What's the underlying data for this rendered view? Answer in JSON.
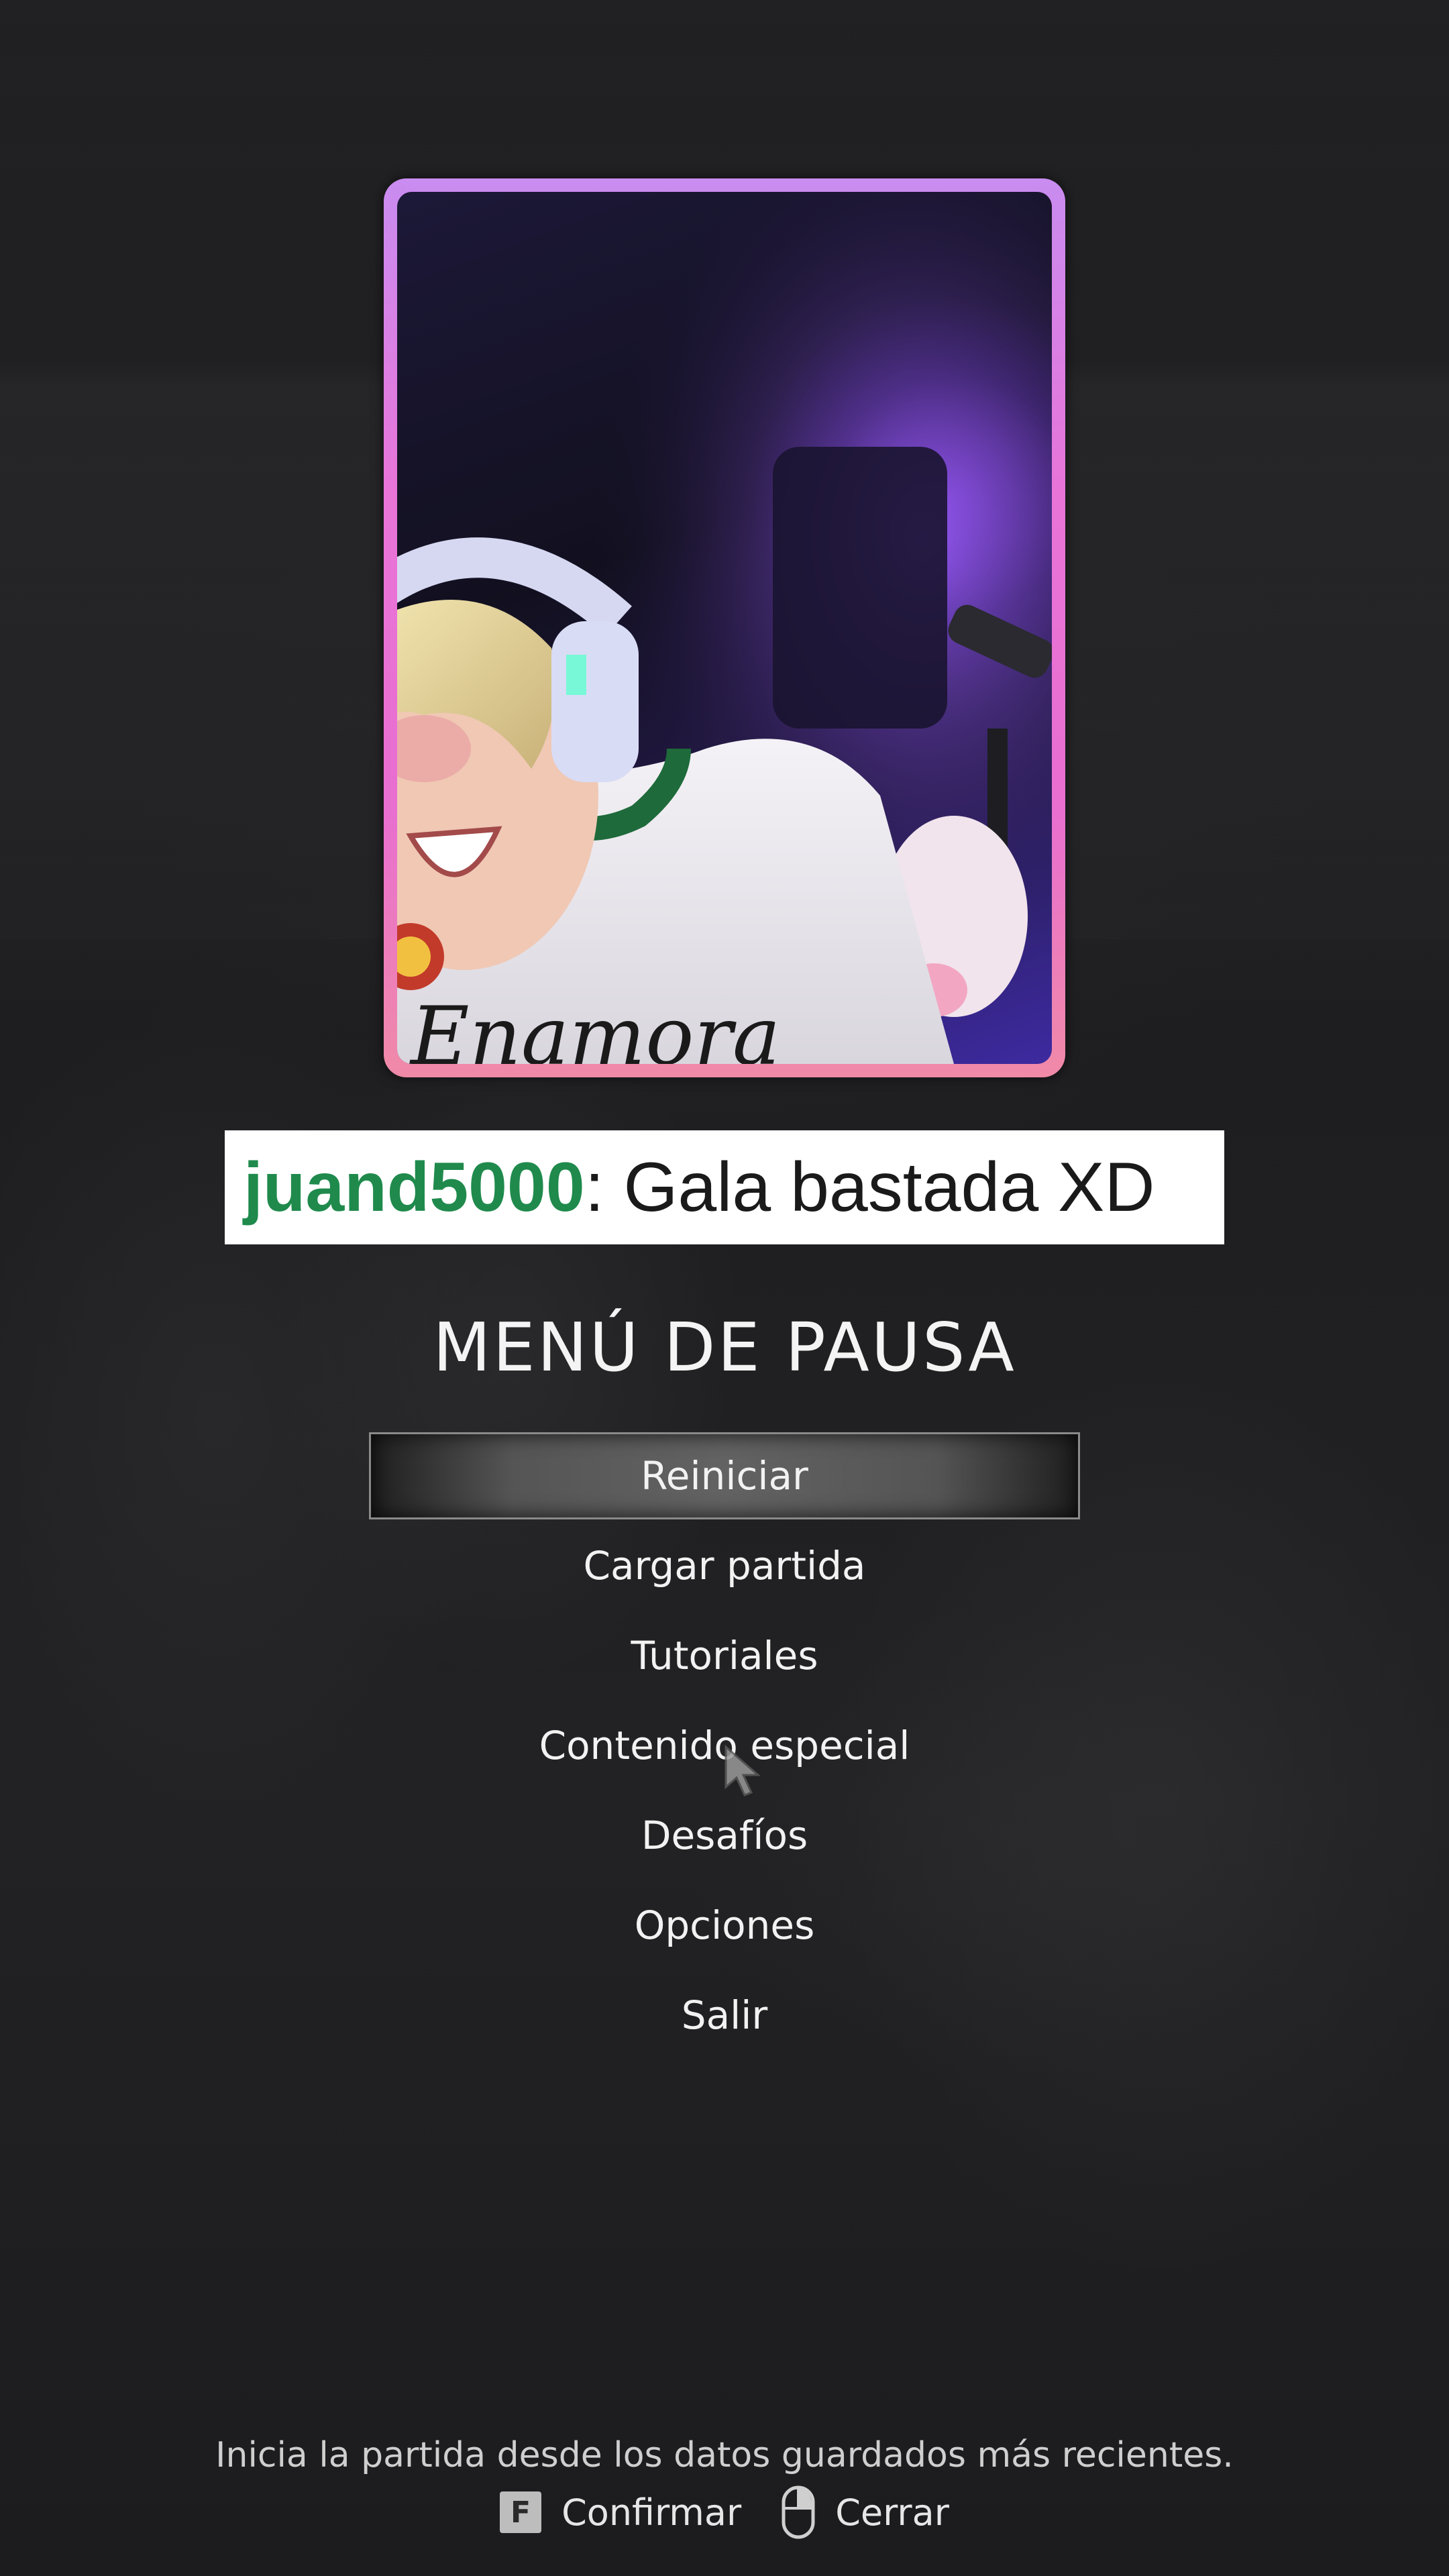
{
  "webcam": {
    "shirt_text": "Enamora"
  },
  "chat": {
    "username": "juand5000",
    "separator": ":",
    "message": " Gala bastada XD",
    "username_color": "#1f8a4c"
  },
  "pause_menu": {
    "title": "MENÚ DE PAUSA",
    "items": [
      {
        "label": "Reiniciar",
        "selected": true
      },
      {
        "label": "Cargar partida",
        "selected": false
      },
      {
        "label": "Tutoriales",
        "selected": false
      },
      {
        "label": "Contenido especial",
        "selected": false
      },
      {
        "label": "Desafíos",
        "selected": false
      },
      {
        "label": "Opciones",
        "selected": false
      },
      {
        "label": "Salir",
        "selected": false
      }
    ]
  },
  "footer": {
    "description": "Inicia la partida desde los datos guardados más recientes.",
    "confirm": {
      "key": "F",
      "label": "Confirmar",
      "icon": "f-key-icon"
    },
    "close": {
      "label": "Cerrar",
      "icon": "mouse-right-click-icon"
    }
  },
  "colors": {
    "webcam_border": "#e874d8",
    "background": "#1b1b1d",
    "selected_highlight": "#6e6e6e"
  }
}
